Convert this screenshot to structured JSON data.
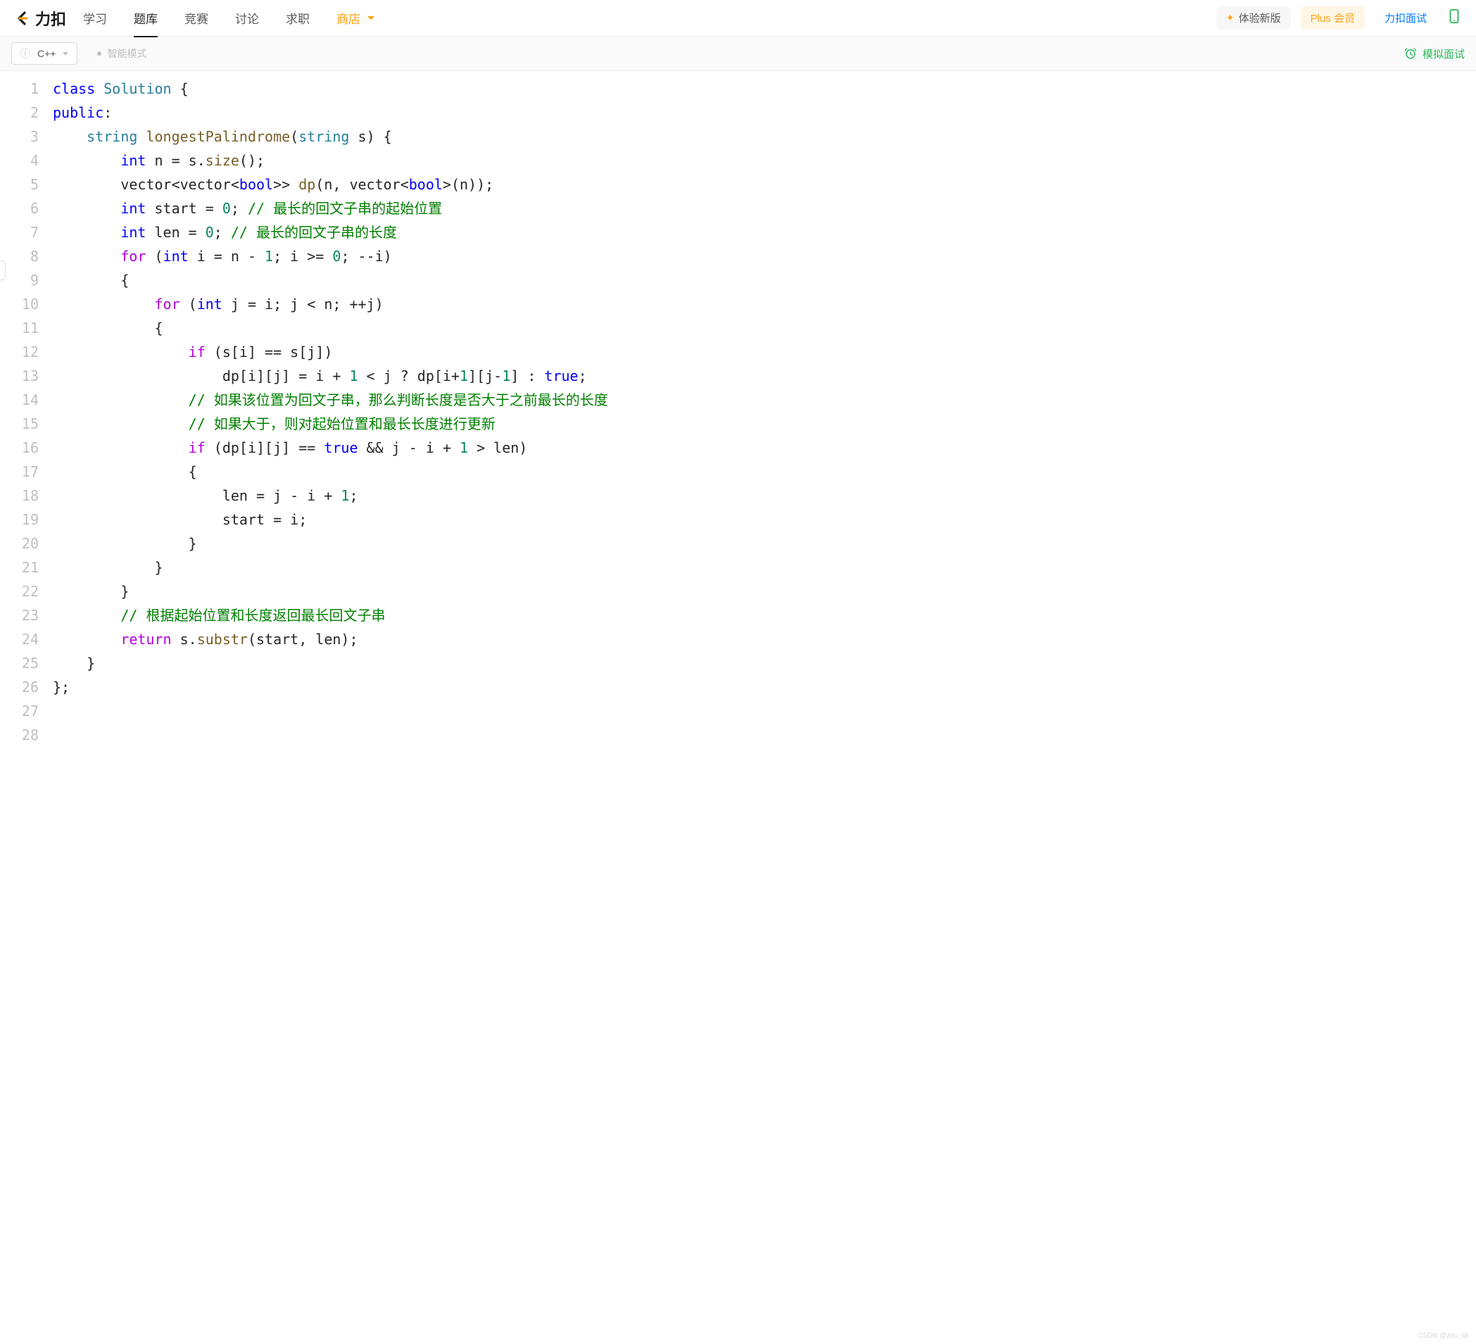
{
  "header": {
    "logo_text": "力扣",
    "nav": {
      "study": "学习",
      "problems": "题库",
      "contest": "竞赛",
      "discuss": "讨论",
      "jobs": "求职",
      "store": "商店"
    },
    "right": {
      "new_version": "体验新版",
      "plus": "Plus 会员",
      "interview": "力扣面试"
    }
  },
  "toolbar": {
    "language": "C++",
    "mode": "智能模式",
    "mock": "模拟面试"
  },
  "code": {
    "line_count": 28,
    "tokens": {
      "class": "class",
      "solution": "Solution",
      "lb": " {",
      "public": "public",
      "colon": ":",
      "string_t": "string",
      "fn": "longestPalindrome",
      "lp": "(",
      "param": " s",
      "rp_lb": ") {",
      "int_kw": "int",
      "n_eq": " n = s.",
      "size": "size",
      "call_end": "();",
      "vec_t": "        vector<vector<",
      "bool_t": "bool",
      "vec_mid": ">> ",
      "dp_fn": "dp",
      "dp_args_a": "(n, vector<",
      "dp_args_b": ">(n));",
      "start_pre": " start = ",
      "zero": "0",
      "sc_sp": "; ",
      "c_start": "// 最长的回文子串的起始位置",
      "len_pre": " len = ",
      "c_len": "// 最长的回文子串的长度",
      "for_kw": "for",
      "outer_a": " (",
      "outer_b": " i = n - ",
      "one": "1",
      "outer_c": "; i >= ",
      "outer_d": "; --i)",
      "obrace9": "        {",
      "inner_a": " j = i; j < n; ++j)",
      "obrace11": "            {",
      "if_kw": "if",
      "if_cond": " (s[i] == s[j])",
      "dp_assign_a": "                    dp[i][j] = i + ",
      "dp_assign_b": " < j ? dp[i+",
      "dp_assign_c": "][j-",
      "dp_assign_d": "] : ",
      "true_kw": "true",
      "semi": ";",
      "c14": "// 如果该位置为回文子串，那么判断长度是否大于之前最长的长度",
      "c15": "// 如果大于，则对起始位置和最长长度进行更新",
      "if2_a": " (dp[i][j] == ",
      "if2_b": " && j - i + ",
      "if2_c": " > len)",
      "obrace17": "                {",
      "len_assign_a": "                    len = j - i + ",
      "start_assign": "                    start = i;",
      "cbrace20": "                }",
      "cbrace21": "            }",
      "cbrace22": "        }",
      "c23": "// 根据起始位置和长度返回最长回文子串",
      "return_kw": "return",
      "ret_a": " s.",
      "substr": "substr",
      "ret_b": "(start, len);",
      "cbrace25": "    }",
      "end": "};"
    }
  },
  "watermark": "CSDN @zou_tjk"
}
